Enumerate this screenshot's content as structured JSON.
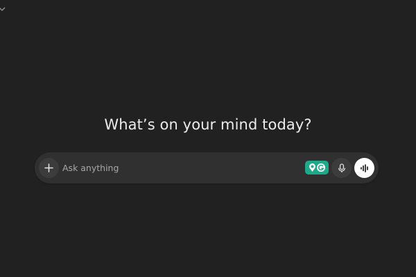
{
  "main": {
    "headline": "What’s on your mind today?"
  },
  "composer": {
    "placeholder": "Ask anything",
    "value": ""
  },
  "icons": {
    "corner": "chevron-down-icon",
    "attach": "plus-icon",
    "extension": "grammarly-extension-icon",
    "dictate": "microphone-icon",
    "voice": "voice-mode-icon"
  },
  "colors": {
    "background": "#212121",
    "composer_background": "#303030",
    "extension_accent": "#1ea98b",
    "text_primary": "#ececec",
    "text_placeholder": "#a8a8a8"
  }
}
